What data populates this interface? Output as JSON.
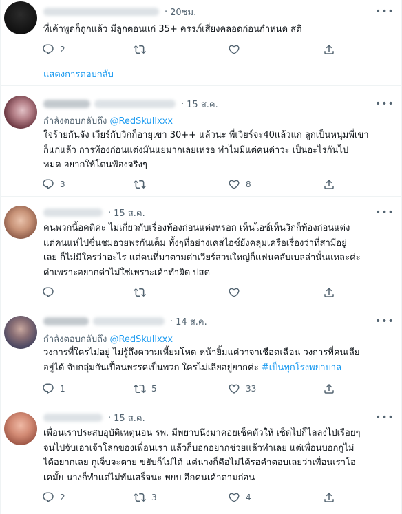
{
  "icons": {
    "more": "more-horizontal-icon",
    "reply": "reply-icon",
    "retweet": "retweet-icon",
    "like": "heart-icon",
    "share": "share-icon"
  },
  "colors": {
    "link": "#1d9bf0",
    "secondary": "#536471",
    "text": "#0f1419",
    "divider": "#eff3f4"
  },
  "thread": {
    "show_replies_label": "แสดงการตอบกลับ"
  },
  "tweets": [
    {
      "time": "20ชม.",
      "replying_prefix": "",
      "replying_handle": "",
      "text": "ที่เค้าพูดก็ถูกแล้ว มีลูกตอนแก่ 35+ ครรภ์เสี่ยงคลอดก่อนกำหนด สติ",
      "reply_count": "2",
      "retweet_count": "",
      "like_count": ""
    },
    {
      "time": "15 ส.ค.",
      "replying_prefix": "กำลังตอบกลับถึง ",
      "replying_handle": "@RedSkullxxx",
      "text_lines": [
        "ใจร้ายกันจัง เวียร์กับวิกก็อายุเขา 30++ แล้วนะ พี่เวียร์จะ40แล้วแก ลูกเป็นหนุ่มพี่เขา",
        "ก็แก่แล้ว การท้องก่อนแต่งมันแย่มากเลยเหรอ ทำไมมีแต่คนด่าวะ เป็นอะไรกันไป",
        "หมด อยากให้โดนฟ้องจริงๆ"
      ],
      "reply_count": "3",
      "retweet_count": "",
      "like_count": "8"
    },
    {
      "time": "15 ส.ค.",
      "text_lines": [
        "คนพวกนี้อคติค่ะ ไม่เกี่ยวกับเรื่องท้องก่อนแต่งหรอก เห็นไอซ์เห็นวิกก็ท้องก่อนแต่ง",
        "แต่คนแห่ไปชื่นชมอวยพรกันเต็ม ทั้งๆที่อย่างเคสไอซ์ยังคลุมเครือเรื่องว่าที่สามีอยู่",
        "เลย ก็ไม่มีใครว่าอะไร แต่คนที่มาตามด่าเวียร์ส่วนใหญ่ก็แฟนคลับเบลล่านั่นแหละค่ะ",
        "ด่าเพราะอยากด่าไม่ใช่เพราะเค้าทำผิด ปสด"
      ],
      "reply_count": "",
      "retweet_count": "",
      "like_count": ""
    },
    {
      "time": "14 ส.ค.",
      "replying_prefix": "กำลังตอบกลับถึง ",
      "replying_handle": "@RedSkullxxx",
      "text_line1": "วงการที่ใครไม่อยู่ ไม่รู้ถึงความเหี้ยมโหด หน้ายิ้มแต่วาจาเชือดเฉือน วงการที่คนเลีย",
      "text_line2_prefix": "อยู่ได้ จับกลุ่มกันเปื้อนพรรคเป็นพวก ใครไม่เลียอยู่ยากค่ะ ",
      "hashtag": "#เป็นทุกโรงพยาบาล",
      "reply_count": "1",
      "retweet_count": "5",
      "like_count": "33"
    },
    {
      "time": "15 ส.ค.",
      "text_lines": [
        "เพื่อนเราประสบอุบัติเหตุนอน รพ. มีพยาบนึงมาคอยเช็คตัวให้ เช็ดไปก็ไลลงไปเรื่อยๆ",
        "จนไปจับเอาเจ้าโลกของเพื่อนเรา แล้วก็บอกอยากช่วยแล้วทำเลย แต่เพื่อนบอกกูไม่",
        "ได้อยากเลย กูเจ็บจะตาย ขยับก็ไม่ได้ แต่นางก็คือไม่ได้รอคำตอบเลยว่าเพื่อนเราโอ",
        "เคมั้ย นางก็ทำแต่ไม่ทันเสร็จนะ พยบ อีกคนเค้าตามก่อน"
      ],
      "reply_count": "2",
      "retweet_count": "3",
      "like_count": "4"
    }
  ]
}
